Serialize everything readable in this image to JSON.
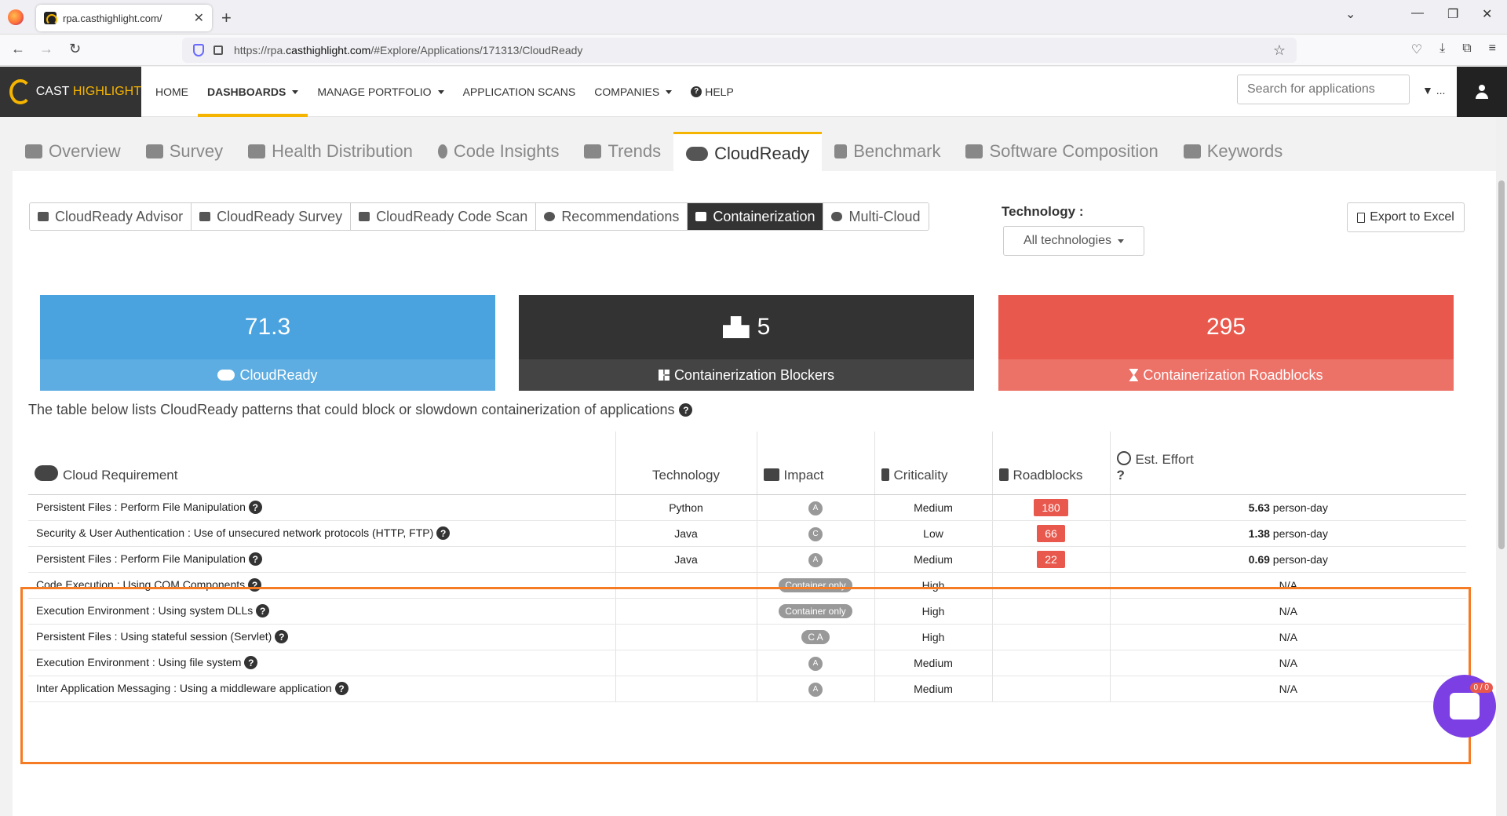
{
  "browser": {
    "tab_title": "rpa.casthighlight.com/",
    "url_prefix": "https://rpa.",
    "url_domain": "casthighlight.com",
    "url_suffix": "/#Explore/Applications/171313/CloudReady"
  },
  "header": {
    "logo_main": "CAST",
    "logo_hl": "HIGHLIGHT",
    "nav": [
      {
        "label": "HOME"
      },
      {
        "label": "DASHBOARDS"
      },
      {
        "label": "MANAGE PORTFOLIO"
      },
      {
        "label": "APPLICATION SCANS"
      },
      {
        "label": "COMPANIES"
      },
      {
        "label": "HELP"
      }
    ],
    "search_placeholder": "Search for applications",
    "filter_more": "..."
  },
  "page_tabs": [
    {
      "label": "Overview"
    },
    {
      "label": "Survey"
    },
    {
      "label": "Health Distribution"
    },
    {
      "label": "Code Insights"
    },
    {
      "label": "Trends"
    },
    {
      "label": "CloudReady"
    },
    {
      "label": "Benchmark"
    },
    {
      "label": "Software Composition"
    },
    {
      "label": "Keywords"
    }
  ],
  "subnav": [
    {
      "label": "CloudReady Advisor"
    },
    {
      "label": "CloudReady Survey"
    },
    {
      "label": "CloudReady Code Scan"
    },
    {
      "label": "Recommendations"
    },
    {
      "label": "Containerization"
    },
    {
      "label": "Multi-Cloud"
    }
  ],
  "technology": {
    "label": "Technology :",
    "selected": "All technologies"
  },
  "export_label": "Export to Excel",
  "kpis": [
    {
      "value": "71.3",
      "label": "CloudReady"
    },
    {
      "value": "5",
      "label": "Containerization Blockers"
    },
    {
      "value": "295",
      "label": "Containerization Roadblocks"
    }
  ],
  "description": "The table below lists CloudReady patterns that could block or slowdown containerization of applications",
  "table": {
    "headers": [
      "Cloud Requirement",
      "Technology",
      "Impact",
      "Criticality",
      "Roadblocks",
      "Est. Effort",
      "?"
    ],
    "rows": [
      {
        "req": "Persistent Files : Perform File Manipulation",
        "tech": "Python",
        "impact": "A",
        "crit": "Medium",
        "road": "180",
        "effort_num": "5.63",
        "effort_unit": " person-day"
      },
      {
        "req": "Security & User Authentication : Use of unsecured network protocols (HTTP, FTP)",
        "tech": "Java",
        "impact": "C",
        "crit": "Low",
        "road": "66",
        "effort_num": "1.38",
        "effort_unit": " person-day"
      },
      {
        "req": "Persistent Files : Perform File Manipulation",
        "tech": "Java",
        "impact": "A",
        "crit": "Medium",
        "road": "22",
        "effort_num": "0.69",
        "effort_unit": " person-day"
      },
      {
        "req": "Code Execution : Using COM Components",
        "tech": "",
        "impact": "Container only",
        "crit": "High",
        "road": "",
        "effort_num": "",
        "effort_unit": "N/A"
      },
      {
        "req": "Execution Environment : Using system DLLs",
        "tech": "",
        "impact": "Container only",
        "crit": "High",
        "road": "",
        "effort_num": "",
        "effort_unit": "N/A"
      },
      {
        "req": "Persistent Files : Using stateful session (Servlet)",
        "tech": "",
        "impact": "C A",
        "crit": "High",
        "road": "",
        "effort_num": "",
        "effort_unit": "N/A"
      },
      {
        "req": "Execution Environment : Using file system",
        "tech": "",
        "impact": "A",
        "crit": "Medium",
        "road": "",
        "effort_num": "",
        "effort_unit": "N/A"
      },
      {
        "req": "Inter Application Messaging : Using a middleware application",
        "tech": "",
        "impact": "A",
        "crit": "Medium",
        "road": "",
        "effort_num": "",
        "effort_unit": "N/A"
      }
    ]
  },
  "chat_count": "0 / 0",
  "colors": {
    "accent": "#f5b400",
    "blue": "#4aa3df",
    "dark": "#333333",
    "red": "#e8584d",
    "highlight": "#f57c24",
    "chat": "#7b3fe4"
  }
}
